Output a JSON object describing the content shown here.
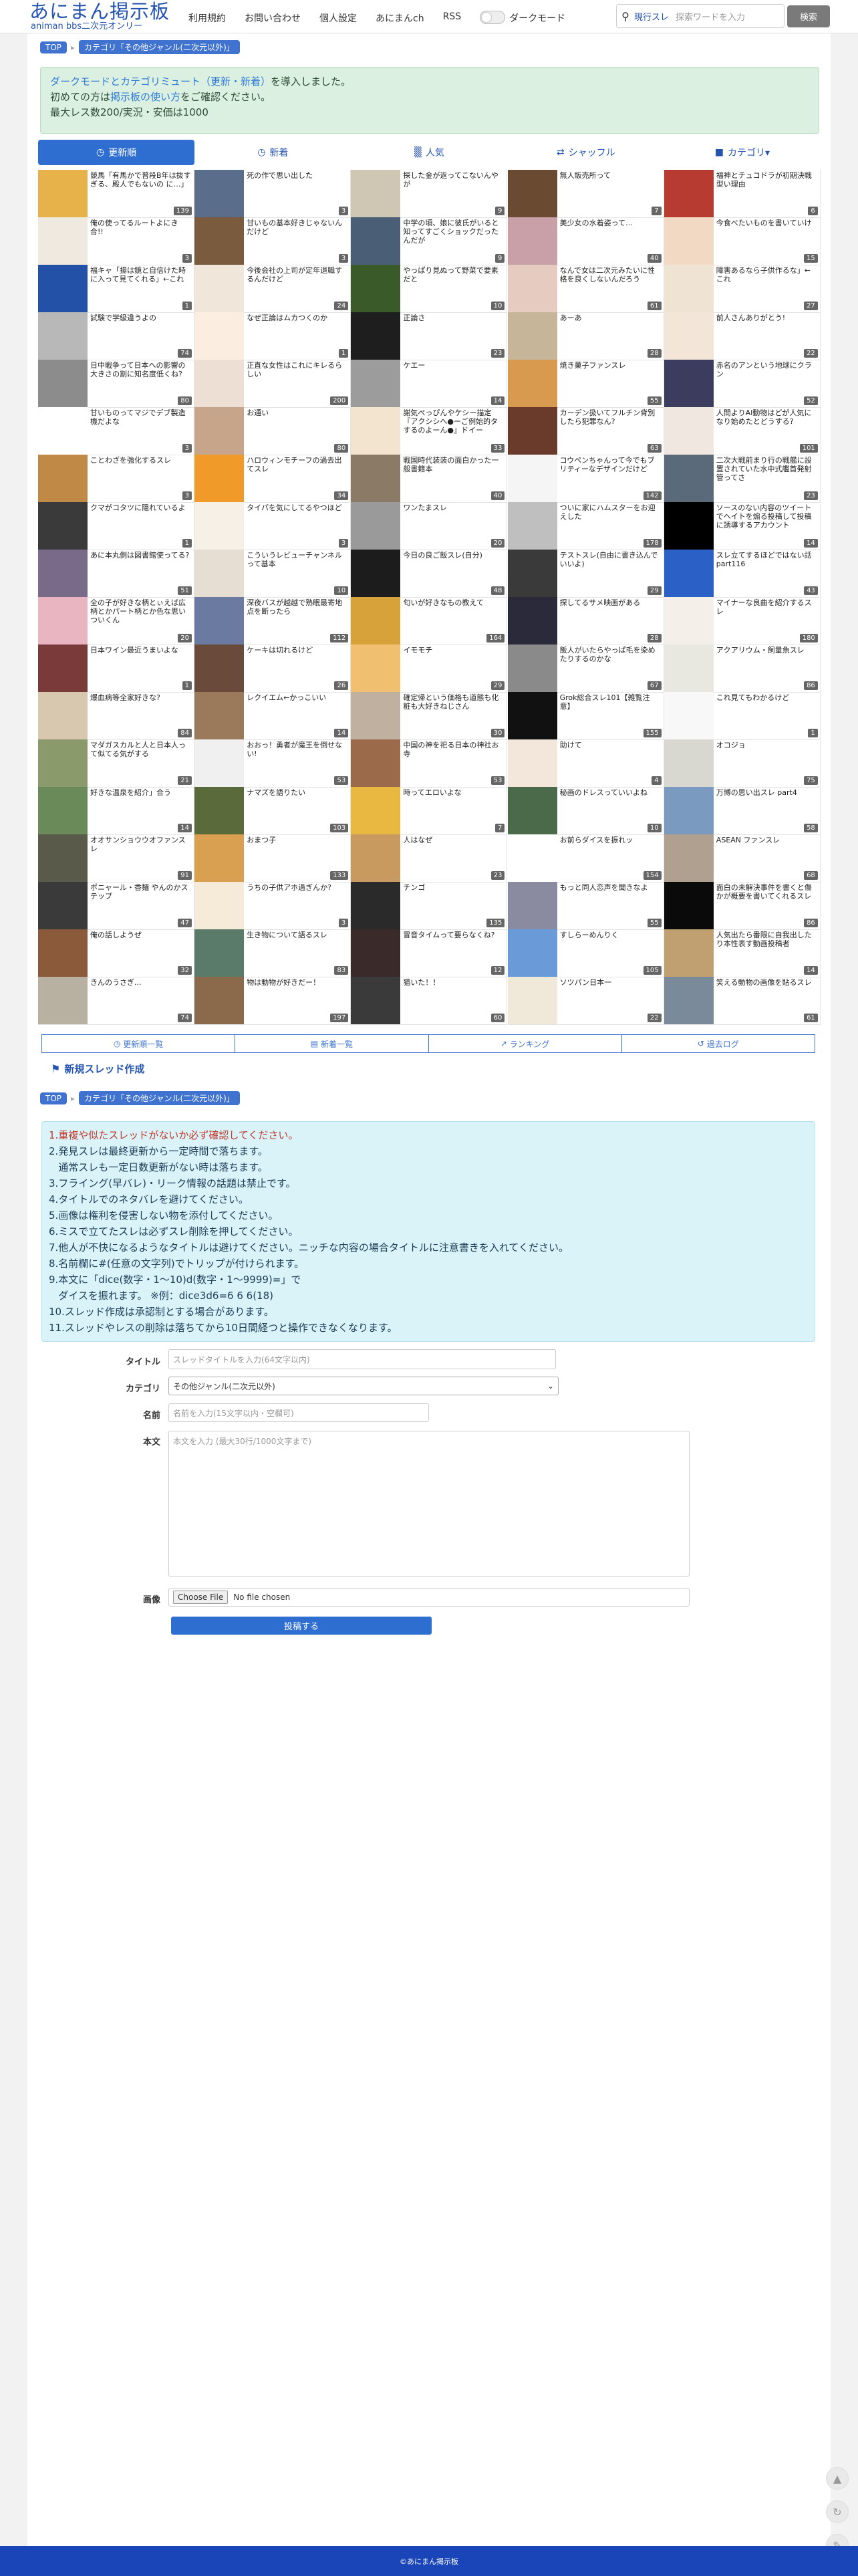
{
  "header": {
    "logo_title": "あにまん掲示板",
    "logo_sub": "animan bbs二次元オンリー",
    "nav": [
      "利用規約",
      "お問い合わせ",
      "個人設定",
      "あにまんch",
      "RSS"
    ],
    "dark_mode": "ダークモード",
    "search_scope": "現行スレ",
    "search_placeholder": "探索ワードを入力",
    "search_button": "検索"
  },
  "breadcrumb": {
    "top": "TOP",
    "category": "カテゴリ「その他ジャンル(二次元以外)」"
  },
  "notice": {
    "line1_link": "ダークモードとカテゴリミュート（更新・新着）",
    "line1_rest": "を導入しました。",
    "line2_pre": "初めての方は",
    "line2_link": "掲示板の使い方",
    "line2_post": "をご確認ください。",
    "line3": "最大レス数200/実況・安価は1000"
  },
  "tabs": [
    {
      "label": "更新順",
      "icon": "clock-icon",
      "active": true
    },
    {
      "label": "新着",
      "icon": "clock-icon"
    },
    {
      "label": "人気",
      "icon": "bar-chart-icon"
    },
    {
      "label": "シャッフル",
      "icon": "shuffle-icon"
    },
    {
      "label": "カテゴリ▾",
      "icon": "folder-icon"
    }
  ],
  "threads": [
    {
      "title": "競馬「有馬かで普段B年は抜すぎる、殿人でもないの に…」",
      "count": "139",
      "color": "#e8b24a"
    },
    {
      "title": "死の作で思い出した",
      "count": "3",
      "color": "#5a6e8c"
    },
    {
      "title": "探した金が返ってこないんやが",
      "count": "9",
      "color": "#d0c6b4"
    },
    {
      "title": "無人販売所って",
      "count": "7",
      "color": "#6a4a30"
    },
    {
      "title": "福神とチュコドラが初期決戦型い理由",
      "count": "6",
      "color": "#b83b32"
    },
    {
      "title": "俺の使ってるルートよにき合!!",
      "count": "3",
      "color": "#efe9df"
    },
    {
      "title": "甘いもの基本好きじゃないんだけど",
      "count": "3",
      "color": "#7a5b3e"
    },
    {
      "title": "中学の頃、娘に彼氏がいると知ってすごくショックだったんだが",
      "count": "9",
      "color": "#4a5e75"
    },
    {
      "title": "美少女の水着姿って…",
      "count": "40",
      "color": "#c9a0a8"
    },
    {
      "title": "今食べたいものを書いていけ",
      "count": "15",
      "color": "#f2d9c4"
    },
    {
      "title": "福キャ「揚は鏡と自信けた時に入って見てくれる」←これ",
      "count": "1",
      "color": "#2351a8"
    },
    {
      "title": "今後会社の上司が定年退職するんだけど",
      "count": "24",
      "color": "#f0e6da"
    },
    {
      "title": "やっぱり見ぬって野菜で要素 だと",
      "count": "10",
      "color": "#3a5a2a"
    },
    {
      "title": "なんで女は二次元みたいに性格を良くしないんだろう",
      "count": "61",
      "color": "#e6cbc1"
    },
    {
      "title": "障害あるなら子供作るな」←これ",
      "count": "27",
      "color": "#efe3d3"
    },
    {
      "title": "試験で学級違うよの",
      "count": "74",
      "color": "#b8b8b8"
    },
    {
      "title": "なぜ正論はムカつくのか",
      "count": "1",
      "color": "#fbeee1"
    },
    {
      "title": "正論さ",
      "count": "23",
      "color": "#1e1e1e"
    },
    {
      "title": "あーあ",
      "count": "28",
      "color": "#c7b59a"
    },
    {
      "title": "前人さんありがとう!",
      "count": "22",
      "color": "#f3e6d8"
    },
    {
      "title": "日中戦争って日本への影響の大きさの割に知名度低くね?",
      "count": "80",
      "color": "#8c8c8c"
    },
    {
      "title": "正直な女性はこれにキレるらしい",
      "count": "200",
      "color": "#eedfd4"
    },
    {
      "title": "ケエー",
      "count": "14",
      "color": "#9c9c9c"
    },
    {
      "title": "焼き菓子ファンスレ",
      "count": "55",
      "color": "#d89a4f"
    },
    {
      "title": "赤名のアンという地球にクラン",
      "count": "52",
      "color": "#3c3c5e"
    },
    {
      "title": "甘いものってマジでデブ製造機だよな",
      "count": "3",
      "color": "#ffffff"
    },
    {
      "title": "お通い",
      "count": "80",
      "color": "#c7a58a"
    },
    {
      "title": "謝気ぺっぴんやケシー描定『アクシシへ●ーご例始的タするのよーん●』ドイー",
      "count": "33",
      "color": "#f3e4d0"
    },
    {
      "title": "カーデン扱いてフルチン背別したら犯罪なん?",
      "count": "63",
      "color": "#6a3a2a"
    },
    {
      "title": "人間よりAI動物はどが人気になり始めたとどうする?",
      "count": "101",
      "color": "#f0e8e0"
    },
    {
      "title": "ことわざを強化するスレ",
      "count": "3",
      "color": "#c08a46"
    },
    {
      "title": "ハロウィンモチーフの過去出てスレ",
      "count": "34",
      "color": "#f09a2a"
    },
    {
      "title": "戦国時代装装の面白かった一般書籍本",
      "count": "40",
      "color": "#8a7a66"
    },
    {
      "title": "コウペンちゃんって今でもブリティーなデザインだけど",
      "count": "142",
      "color": "#f5f5f5"
    },
    {
      "title": "二次大戦前まり行の戦艦に設置されていた水中式艦首発射管ってさ",
      "count": "23",
      "color": "#5a6a7a"
    },
    {
      "title": "クマがコタツに隠れているよ",
      "count": "1",
      "color": "#3a3a3a"
    },
    {
      "title": "タイパを気にしてるやつほど",
      "count": "3",
      "color": "#f6f0e6"
    },
    {
      "title": "ワンたまスレ",
      "count": "20",
      "color": "#9a9a9a"
    },
    {
      "title": "ついに家にハムスターをお迎えした",
      "count": "178",
      "color": "#bfbfbf"
    },
    {
      "title": "ソースのない内容のツイートでヘイトを煽る投稿して投稿に誘導するアカウント",
      "count": "14",
      "color": "#000000"
    },
    {
      "title": "あに本丸側は図書館使ってる?",
      "count": "51",
      "color": "#7a6a8a"
    },
    {
      "title": "こういうレビューチャンネルって基本",
      "count": "10",
      "color": "#e6ddd3"
    },
    {
      "title": "今日の良ご飯スレ(自分)",
      "count": "48",
      "color": "#1c1c1c"
    },
    {
      "title": "テストスレ(自由に書き込んでいいよ)",
      "count": "29",
      "color": "#3a3a3a"
    },
    {
      "title": "スレ立てするほどではない話part116",
      "count": "43",
      "color": "#2b60c6"
    },
    {
      "title": "全の子が好きな柄とぃえば広柄とかパート柄とか色な思いついくん",
      "count": "20",
      "color": "#e9b5c0"
    },
    {
      "title": "深夜バスが越越で熟眠最寄地点を断ったら",
      "count": "112",
      "color": "#6a7aa0"
    },
    {
      "title": "匂いが好きなもの教えて",
      "count": "164",
      "color": "#d7a23a"
    },
    {
      "title": "探してるサメ映画がある",
      "count": "28",
      "color": "#2a2a3a"
    },
    {
      "title": "マイナーな良曲を紹介するスレ",
      "count": "180",
      "color": "#f4efe8"
    },
    {
      "title": "日本ワイン最近うまいよな",
      "count": "1",
      "color": "#7a3a3a"
    },
    {
      "title": "ケーキは切れるけど",
      "count": "26",
      "color": "#6a4a3a"
    },
    {
      "title": "イモモチ",
      "count": "29",
      "color": "#f0c070"
    },
    {
      "title": "飯人がいたらやっぱ毛を染めたりするのかな",
      "count": "67",
      "color": "#8a8a8a"
    },
    {
      "title": "アクアリウム・飼量魚スレ",
      "count": "86",
      "color": "#e8e8e0"
    },
    {
      "title": "爆血病等全家好きな?",
      "count": "84",
      "color": "#d8c8b0"
    },
    {
      "title": "レクイエム←かっこいい",
      "count": "14",
      "color": "#9a7a5a"
    },
    {
      "title": "確定帰という価格も道態も化粧も大好きねじさん",
      "count": "30",
      "color": "#c0b0a0"
    },
    {
      "title": "Grok総合スレ101【雑覧注意】",
      "count": "155",
      "color": "#111111"
    },
    {
      "title": "これ見てもわかるけど",
      "count": "1",
      "color": "#f8f8f8"
    },
    {
      "title": "マダガスカルと人と日本人って似てる気がする",
      "count": "21",
      "color": "#8a9a6a"
    },
    {
      "title": "おおっ！勇者が魔王を倒せない!",
      "count": "53",
      "color": "#f0f0f0"
    },
    {
      "title": "中国の神を祀る日本の神社お寺",
      "count": "53",
      "color": "#9a6a4a"
    },
    {
      "title": "助けて",
      "count": "4",
      "color": "#f3e6da"
    },
    {
      "title": "オコジョ",
      "count": "75",
      "color": "#d8d8d0"
    },
    {
      "title": "好きな温泉を紹介」合う",
      "count": "14",
      "color": "#6a8a5a"
    },
    {
      "title": "ナマズを語りたい",
      "count": "103",
      "color": "#5a6a3a"
    },
    {
      "title": "時ってエロいよな",
      "count": "7",
      "color": "#e8b840"
    },
    {
      "title": "秘画のドレスっていいよね",
      "count": "10",
      "color": "#4a6a4a"
    },
    {
      "title": "万博の思い出スレ part4",
      "count": "58",
      "color": "#7a9ac0"
    },
    {
      "title": "オオサンショウウオファンスレ",
      "count": "91",
      "color": "#5a5a4a"
    },
    {
      "title": "おまつ子",
      "count": "133",
      "color": "#d8a050"
    },
    {
      "title": "人はなぜ",
      "count": "23",
      "color": "#c89a60"
    },
    {
      "title": "お前らダイスを振れッ",
      "count": "154",
      "color": "#ffffff"
    },
    {
      "title": "ASEAN ファンスレ",
      "count": "68",
      "color": "#b0a090"
    },
    {
      "title": "ポニャール・香麺 やんのかステップ",
      "count": "47",
      "color": "#3a3a3a"
    },
    {
      "title": "うちの子供アホ過ぎんか?",
      "count": "3",
      "color": "#f6ebd8"
    },
    {
      "title": "チンゴ",
      "count": "135",
      "color": "#2a2a2a"
    },
    {
      "title": "もっと同人恋声を聞きなよ",
      "count": "55",
      "color": "#8a8aa0"
    },
    {
      "title": "面白の未解決事件を書くと傷かが概要を書いてくれるスレ",
      "count": "86",
      "color": "#0a0a0a"
    },
    {
      "title": "俺の話しようぜ",
      "count": "32",
      "color": "#8a5a3a"
    },
    {
      "title": "生き物について語るスレ",
      "count": "83",
      "color": "#5a7a6a"
    },
    {
      "title": "冒音タイムって要らなくね?",
      "count": "12",
      "color": "#3a2a2a"
    },
    {
      "title": "すしらーめんりく",
      "count": "105",
      "color": "#6a9ad8"
    },
    {
      "title": "人気出たら番限に自我出したり本性表す動画投稿者",
      "count": "14",
      "color": "#c0a070"
    },
    {
      "title": "きんのうさぎ...",
      "count": "74",
      "color": "#b8b0a0"
    },
    {
      "title": "物は動物が好きだー！",
      "count": "197",
      "color": "#8a6a4a"
    },
    {
      "title": "猫いた！！",
      "count": "60",
      "color": "#3a3a3a"
    },
    {
      "title": "ソツパン日本一",
      "count": "22",
      "color": "#f0e8d8"
    },
    {
      "title": "笑える動物の画像を貼るスレ",
      "count": "61",
      "color": "#7a8a9a"
    }
  ],
  "bottom_buttons": [
    {
      "label": "更新順一覧",
      "icon": "clock-icon"
    },
    {
      "label": "新着一覧",
      "icon": "list-icon"
    },
    {
      "label": "ランキング",
      "icon": "chart-icon"
    },
    {
      "label": "過去ログ",
      "icon": "history-icon"
    }
  ],
  "new_thread": {
    "heading": "新規スレッド作成",
    "rules": [
      "1.重複や似たスレッドがないか必ず確認してください。",
      "2.発見スレは最終更新から一定時間で落ちます。",
      "   通常スレも一定日数更新がない時は落ちます。",
      "3.フライング(早バレ)・リーク情報の話題は禁止です。",
      "4.タイトルでのネタバレを避けてください。",
      "5.画像は権利を侵害しない物を添付してください。",
      "6.ミスで立てたスレは必ずスレ削除を押してください。",
      "7.他人が不快になるようなタイトルは避けてください。ニッチな内容の場合タイトルに注意書きを入れてください。",
      "8.名前欄に#(任意の文字列)でトリップが付けられます。",
      "9.本文に「dice(数字・1〜10)d(数字・1〜9999)=」で",
      "   ダイスを振れます。 ※例：dice3d6=6 6 6(18)",
      "10.スレッド作成は承認制とする場合があります。",
      "11.スレッドやレスの削除は落ちてから10日間経つと操作できなくなります。"
    ],
    "labels": {
      "title": "タイトル",
      "category": "カテゴリ",
      "name": "名前",
      "body": "本文",
      "image": "画像"
    },
    "placeholders": {
      "title": "スレッドタイトルを入力(64文字以内)",
      "name": "名前を入力(15文字以内・空欄可)",
      "body": "本文を入力 (最大30行/1000文字まで)"
    },
    "category_value": "その他ジャンル(二次元以外)",
    "file_button": "Choose File",
    "file_status": "No file chosen",
    "submit": "投稿する"
  },
  "footer": "©あにまん掲示板"
}
